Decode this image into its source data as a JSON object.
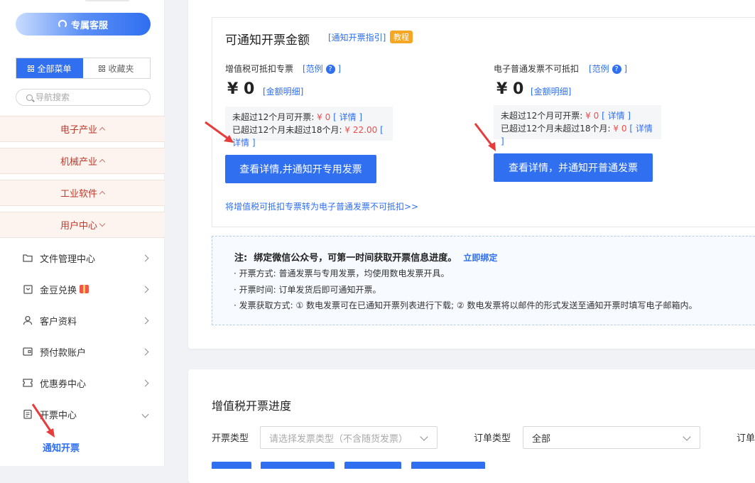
{
  "sidebar": {
    "service_button": "专属客服",
    "tabs": [
      {
        "label": "全部菜单",
        "active": true
      },
      {
        "label": "收藏夹",
        "active": false
      }
    ],
    "search_placeholder": "导航搜索",
    "categories": [
      {
        "label": "电子产业",
        "expanded": false
      },
      {
        "label": "机械产业",
        "expanded": false
      },
      {
        "label": "工业软件",
        "expanded": false
      },
      {
        "label": "用户中心",
        "expanded": true
      }
    ],
    "items": [
      {
        "label": "文件管理中心",
        "icon": "folder-icon"
      },
      {
        "label": "金豆兑换",
        "icon": "wallet-icon"
      },
      {
        "label": "客户资料",
        "icon": "user-icon"
      },
      {
        "label": "预付款账户",
        "icon": "card-icon"
      },
      {
        "label": "优惠券中心",
        "icon": "coupon-icon"
      },
      {
        "label": "开票中心",
        "icon": "invoice-icon",
        "expanded": true
      }
    ],
    "sub_item": "通知开票"
  },
  "invoice": {
    "title": "可通知开票金额",
    "guide_link": "[通知开票指引]",
    "tutorial_tag": "教程",
    "left": {
      "heading": "增值税可抵扣专票",
      "example": "[范例",
      "example_end": "]",
      "amount": "¥ 0",
      "detail_link": "[金额明细]",
      "row1_label": "未超过12个月可开票:",
      "row1_value": "¥ 0",
      "row1_link": "[ 详情 ]",
      "row2_label": "已超过12个月未超过18个月:",
      "row2_value": "¥ 22.00",
      "row2_link": "[ 详情 ]",
      "button": "查看详情,并通知开专用发票",
      "convert_link": "将增值税可抵扣专票转为电子普通发票不可抵扣>>"
    },
    "right": {
      "heading": "电子普通发票不可抵扣",
      "example": "[范例",
      "example_end": "]",
      "amount": "¥ 0",
      "detail_link": "[金额明细]",
      "row1_label": "未超过12个月可开票:",
      "row1_value": "¥ 0",
      "row1_link": "[ 详情 ]",
      "row2_label": "已超过12个月未超过18个月:",
      "row2_value": "¥ 0",
      "row2_link": "[ 详情 ]",
      "button": "查看详情，并通知开普通发票"
    },
    "question_mark": "?"
  },
  "notice": {
    "prefix": "注:",
    "text": "绑定微信公众号，可第一时间获取开票信息进度。",
    "bind_link": "立即绑定",
    "lines": [
      "· 开票方式:  普通发票与专用发票，均使用数电发票开具。",
      "· 开票时间:  订单发货后即可通知开票。",
      "· 发票获取方式:  ① 数电发票可在已通知开票列表进行下载;  ② 数电发票将以邮件的形式发送至通知开票时填写电子邮箱内。"
    ]
  },
  "progress": {
    "title": "增值税开票进度",
    "invoice_type_label": "开票类型",
    "invoice_type_placeholder": "请选择发票类型（不含随货发票）",
    "order_type_label": "订单类型",
    "order_type_value": "全部",
    "cut_label": "订单"
  },
  "colors": {
    "primary": "#2f6ff0",
    "danger": "#f04d4d",
    "tag": "#f5a623",
    "category_text": "#c0392b"
  }
}
